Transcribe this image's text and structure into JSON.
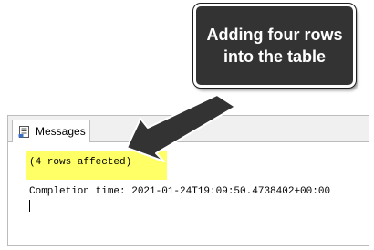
{
  "messages_panel": {
    "tab_label": "Messages",
    "lines": {
      "rows_affected": "(4 rows affected)",
      "completion": "Completion time: 2021-01-24T19:09:50.4738402+00:00"
    },
    "highlight_color": "#ffff66"
  },
  "callout": {
    "text": "Adding four rows into the table",
    "background": "#333333"
  },
  "icons": {
    "tab": "messages-icon"
  }
}
